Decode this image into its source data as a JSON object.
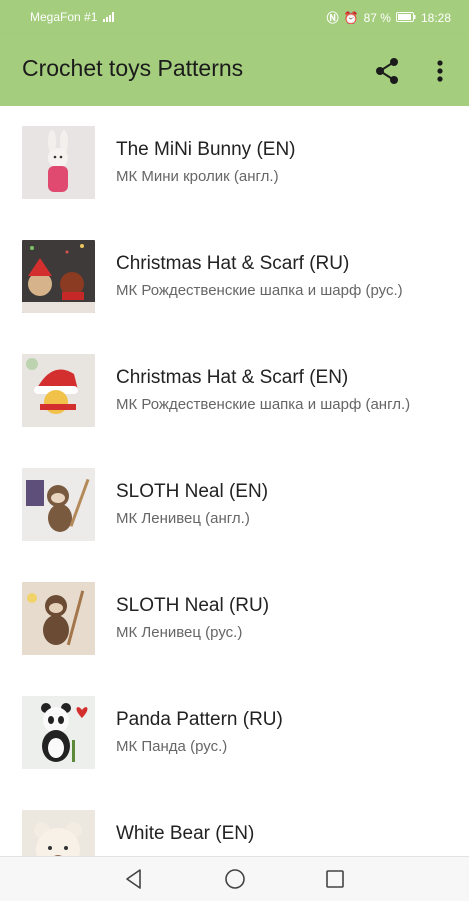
{
  "status": {
    "carrier": "MegaFon #1",
    "battery": "87 %",
    "time": "18:28"
  },
  "appbar": {
    "title": "Crochet toys Patterns",
    "share_icon": "share-icon",
    "more_icon": "more-vert-icon"
  },
  "items": [
    {
      "title": "The MiNi Bunny (EN)",
      "subtitle": "МК Мини кролик (англ.)"
    },
    {
      "title": "Christmas Hat & Scarf (RU)",
      "subtitle": "МК Рождественские шапка и шарф (рус.)"
    },
    {
      "title": "Christmas Hat & Scarf (EN)",
      "subtitle": "МК Рождественские шапка и шарф (англ.)"
    },
    {
      "title": "SLOTH Neal (EN)",
      "subtitle": "МК Ленивец (англ.)"
    },
    {
      "title": "SLOTH Neal (RU)",
      "subtitle": "МК Ленивец (рус.)"
    },
    {
      "title": "Panda Pattern (RU)",
      "subtitle": "МК Панда (рус.)"
    },
    {
      "title": "White Bear (EN)",
      "subtitle": ""
    }
  ],
  "navbar": {
    "back_icon": "back-triangle-icon",
    "home_icon": "home-circle-icon",
    "recents_icon": "recents-square-icon"
  },
  "colors": {
    "accent": "#a4cd7d",
    "title_text": "#222222",
    "subtitle_text": "#666666"
  }
}
